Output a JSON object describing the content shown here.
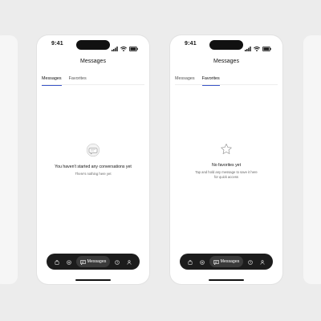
{
  "screens": [
    {
      "status_time": "9:41",
      "title": "Messages",
      "tabs": [
        {
          "label": "Messages",
          "active": true
        },
        {
          "label": "Favorites",
          "active": false
        }
      ],
      "empty_state": {
        "icon": "chat-bubble-icon",
        "title": "You haven't started any conversations yet",
        "subtitle": "There's nothing here yet"
      },
      "nav": {
        "items": [
          "bag-icon",
          "at-sign-icon",
          "messages",
          "help-icon",
          "profile-icon"
        ],
        "active_label": "Messages"
      }
    },
    {
      "status_time": "9:41",
      "title": "Messages",
      "tabs": [
        {
          "label": "Messages",
          "active": false
        },
        {
          "label": "Favorites",
          "active": true
        }
      ],
      "empty_state": {
        "icon": "star-icon",
        "title": "No favorites yet",
        "subtitle_line1": "Tap and hold any message to save it here",
        "subtitle_line2": "for quick access"
      },
      "nav": {
        "items": [
          "bag-icon",
          "at-sign-icon",
          "messages",
          "help-icon",
          "profile-icon"
        ],
        "active_label": "Messages"
      }
    }
  ],
  "colors": {
    "accent": "#3a55c8",
    "nav_bg": "#1c1c1c",
    "background": "#ececec"
  }
}
